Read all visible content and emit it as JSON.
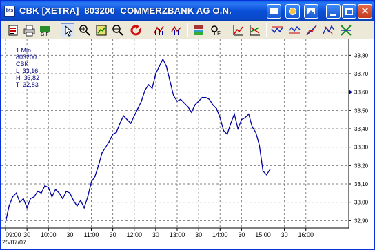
{
  "window": {
    "title": "CBK [XETRA]  803200  COMMERZBANK AG O.N.",
    "app_icon_text": "bts"
  },
  "toolbar": {
    "tools": [
      "print-icon",
      "export-icon",
      "pointer-icon",
      "zoom-in-icon",
      "fit-icon",
      "zoom-out-icon",
      "refresh-icon",
      "indicator-icon",
      "indicator-alt-icon",
      "period-icon",
      "chart-settings-icon",
      "line-draw-icon",
      "channel-icon",
      "trendline-icon",
      "fan-icon",
      "fib-icon",
      "pattern-icon",
      "delete-drawings-icon"
    ]
  },
  "info": {
    "interval": "1 Min",
    "code": "803200",
    "symbol": "CBK",
    "low": "L  33,16",
    "high": "H  33,82",
    "last": "T  32,83"
  },
  "date_label": "25/07/07",
  "chart_data": {
    "type": "line",
    "title": "",
    "xlabel": "",
    "ylabel": "",
    "x_ticks": [
      "09:00",
      "30",
      "10:00",
      "30",
      "11:00",
      "30",
      "12:00",
      "30",
      "13:00",
      "30",
      "14:00",
      "30",
      "15:00",
      "30",
      "16:00"
    ],
    "y_ticks": [
      "33,80",
      "33,70",
      "33,60",
      "33,50",
      "33,40",
      "33,30",
      "33,20",
      "33,10",
      "33,00",
      "32,90"
    ],
    "ylim": [
      32.86,
      33.85
    ],
    "grid": true,
    "color": "#0000a0",
    "last_marker": 33.6,
    "series": [
      {
        "values": [
          [
            0,
            32.89
          ],
          [
            5,
            32.98
          ],
          [
            10,
            33.03
          ],
          [
            15,
            33.05
          ],
          [
            20,
            33.0
          ],
          [
            25,
            33.02
          ],
          [
            30,
            32.97
          ],
          [
            35,
            33.02
          ],
          [
            40,
            33.03
          ],
          [
            45,
            33.06
          ],
          [
            50,
            33.05
          ],
          [
            55,
            33.09
          ],
          [
            60,
            33.08
          ],
          [
            65,
            33.03
          ],
          [
            70,
            33.07
          ],
          [
            75,
            33.05
          ],
          [
            80,
            33.02
          ],
          [
            85,
            33.06
          ],
          [
            90,
            33.05
          ],
          [
            95,
            33.01
          ],
          [
            100,
            32.98
          ],
          [
            105,
            33.01
          ],
          [
            110,
            32.97
          ],
          [
            115,
            33.03
          ],
          [
            120,
            33.11
          ],
          [
            125,
            33.14
          ],
          [
            130,
            33.2
          ],
          [
            135,
            33.27
          ],
          [
            140,
            33.3
          ],
          [
            145,
            33.33
          ],
          [
            150,
            33.37
          ],
          [
            155,
            33.38
          ],
          [
            160,
            33.43
          ],
          [
            165,
            33.47
          ],
          [
            170,
            33.45
          ],
          [
            175,
            33.43
          ],
          [
            180,
            33.47
          ],
          [
            185,
            33.51
          ],
          [
            190,
            33.55
          ],
          [
            195,
            33.61
          ],
          [
            200,
            33.64
          ],
          [
            205,
            33.62
          ],
          [
            210,
            33.7
          ],
          [
            215,
            33.74
          ],
          [
            220,
            33.78
          ],
          [
            225,
            33.74
          ],
          [
            230,
            33.66
          ],
          [
            235,
            33.58
          ],
          [
            240,
            33.55
          ],
          [
            245,
            33.56
          ],
          [
            250,
            33.54
          ],
          [
            255,
            33.52
          ],
          [
            260,
            33.49
          ],
          [
            265,
            33.53
          ],
          [
            270,
            33.55
          ],
          [
            275,
            33.57
          ],
          [
            280,
            33.57
          ],
          [
            285,
            33.56
          ],
          [
            290,
            33.53
          ],
          [
            295,
            33.51
          ],
          [
            300,
            33.46
          ],
          [
            305,
            33.39
          ],
          [
            310,
            33.37
          ],
          [
            315,
            33.43
          ],
          [
            320,
            33.48
          ],
          [
            325,
            33.4
          ],
          [
            330,
            33.45
          ],
          [
            335,
            33.46
          ],
          [
            340,
            33.48
          ],
          [
            345,
            33.41
          ],
          [
            350,
            33.38
          ],
          [
            355,
            33.31
          ],
          [
            360,
            33.17
          ],
          [
            365,
            33.15
          ],
          [
            370,
            33.18
          ]
        ]
      }
    ]
  }
}
